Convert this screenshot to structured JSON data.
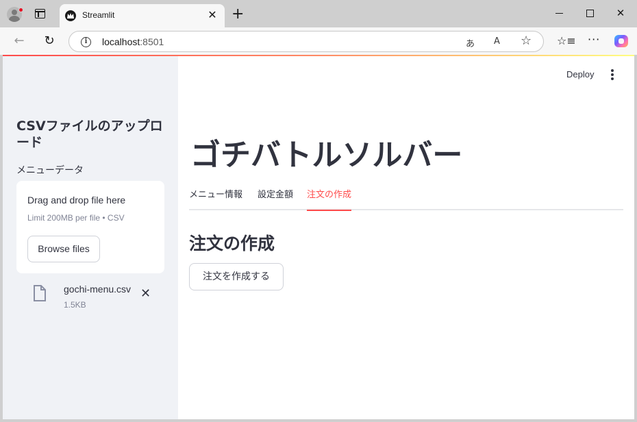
{
  "browser": {
    "tab_title": "Streamlit",
    "tab_close_glyph": "✕",
    "new_tab_glyph": "+",
    "url_host": "localhost",
    "url_port": ":8501",
    "nav_back_glyph": "←",
    "nav_refresh_glyph": "↻",
    "translate_glyph": "あ",
    "read_aloud_glyph": "A",
    "star_glyph": "☆",
    "favorites_glyph": "☆≡",
    "more_glyph": "···",
    "close_glyph": "✕",
    "accent_color": "#ff4b4b"
  },
  "sidebar": {
    "title": "CSVファイルのアップロード",
    "uploader_label": "メニューデータ",
    "dropzone": {
      "main_text": "Drag and drop file here",
      "sub_text": "Limit 200MB per file • CSV",
      "browse_label": "Browse files"
    },
    "file": {
      "name": "gochi-menu.csv",
      "size": "1.5KB",
      "remove_glyph": "✕"
    }
  },
  "main": {
    "deploy_label": "Deploy",
    "title": "ゴチバトルソルバー",
    "tabs": [
      {
        "label": "メニュー情報",
        "active": false
      },
      {
        "label": "設定金額",
        "active": false
      },
      {
        "label": "注文の作成",
        "active": true
      }
    ],
    "section_title": "注文の作成",
    "create_button_label": "注文を作成する"
  }
}
